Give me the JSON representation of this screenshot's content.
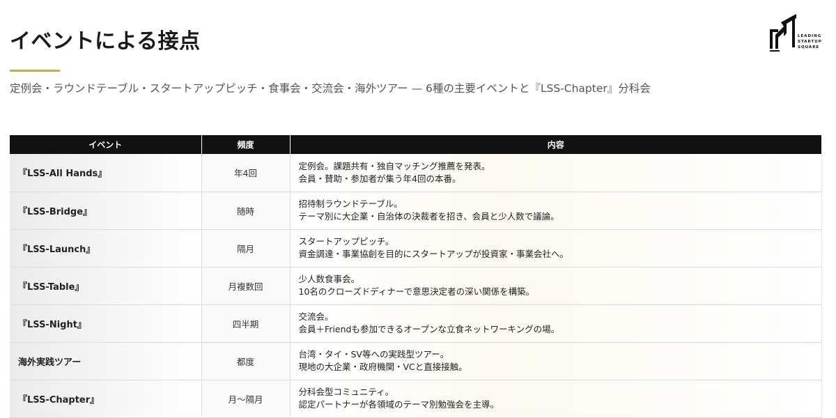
{
  "header": {
    "title": "イベントによる接点",
    "subtitle": "定例会・ラウンドテーブル・スタートアップピッチ・食事会・交流会・海外ツアー — 6種の主要イベントと『LSS-Chapter』分科会"
  },
  "logo": {
    "line1": "LEADING",
    "line2": "STARTUP",
    "line3": "SQUARE"
  },
  "colors": {
    "accent_gold": "#c9a94e",
    "header_bg": "#111111"
  },
  "table": {
    "headers": [
      "イベント",
      "頻度",
      "内容"
    ],
    "rows": [
      {
        "name": "『LSS-All Hands』",
        "freq": "年4回",
        "line1": "定例会。課題共有・独自マッチング推薦を発表。",
        "line2": "会員・賛助・参加者が集う年4回の本番。"
      },
      {
        "name": "『LSS-Bridge』",
        "freq": "随時",
        "line1": "招待制ラウンドテーブル。",
        "line2": "テーマ別に大企業・自治体の決裁者を招き、会員と少人数で議論。"
      },
      {
        "name": "『LSS-Launch』",
        "freq": "隔月",
        "line1": "スタートアップピッチ。",
        "line2": "資金調達・事業協創を目的にスタートアップが投資家・事業会社へ。"
      },
      {
        "name": "『LSS-Table』",
        "freq": "月複数回",
        "line1": "少人数食事会。",
        "line2": "10名のクローズドディナーで意思決定者の深い関係を構築。"
      },
      {
        "name": "『LSS-Night』",
        "freq": "四半期",
        "line1": "交流会。",
        "line2": "会員＋Friendも参加できるオープンな立食ネットワーキングの場。"
      },
      {
        "name": "海外実践ツアー",
        "freq": "都度",
        "line1": "台湾・タイ・SV等への実践型ツアー。",
        "line2": "現地の大企業・政府機関・VCと直接接触。"
      },
      {
        "name": "『LSS-Chapter』",
        "freq": "月〜隔月",
        "line1": "分科会型コミュニティ。",
        "line2": "認定パートナーが各領域のテーマ別勉強会を主導。"
      }
    ]
  }
}
